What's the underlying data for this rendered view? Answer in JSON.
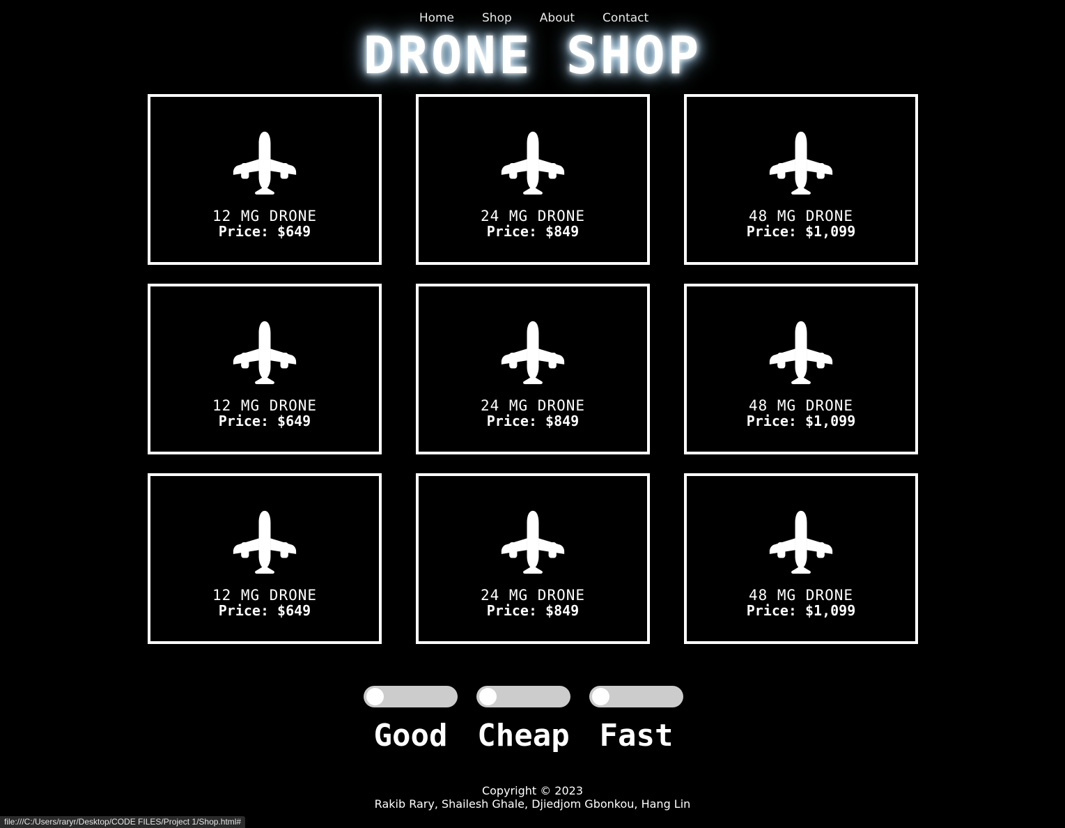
{
  "nav": {
    "items": [
      "Home",
      "Shop",
      "About",
      "Contact"
    ]
  },
  "header": {
    "title": "DRONE SHOP"
  },
  "products": [
    {
      "name": "12 MG DRONE",
      "price": "Price: $649",
      "icon": "airplane-icon"
    },
    {
      "name": "24 MG DRONE",
      "price": "Price: $849",
      "icon": "airplane-icon"
    },
    {
      "name": "48 MG DRONE",
      "price": "Price: $1,099",
      "icon": "airplane-icon"
    },
    {
      "name": "12 MG DRONE",
      "price": "Price: $649",
      "icon": "airplane-icon"
    },
    {
      "name": "24 MG DRONE",
      "price": "Price: $849",
      "icon": "airplane-icon"
    },
    {
      "name": "48 MG DRONE",
      "price": "Price: $1,099",
      "icon": "airplane-icon"
    },
    {
      "name": "12 MG DRONE",
      "price": "Price: $649",
      "icon": "airplane-icon"
    },
    {
      "name": "24 MG DRONE",
      "price": "Price: $849",
      "icon": "airplane-icon"
    },
    {
      "name": "48 MG DRONE",
      "price": "Price: $1,099",
      "icon": "airplane-icon"
    }
  ],
  "toggles": [
    {
      "label": "Good",
      "on": false
    },
    {
      "label": "Cheap",
      "on": false
    },
    {
      "label": "Fast",
      "on": false
    }
  ],
  "footer": {
    "copyright": "Copyright © 2023",
    "authors": "Rakib Rary, Shailesh Ghale, Djiedjom Gbonkou, Hang Lin"
  },
  "statusbar": {
    "url": "file:///C:/Users/raryr/Desktop/CODE FILES/Project 1/Shop.html#"
  },
  "colors": {
    "background": "#000000",
    "foreground": "#ffffff",
    "toggle_track": "#cccccc",
    "title_glow": "#9fd6ff"
  }
}
